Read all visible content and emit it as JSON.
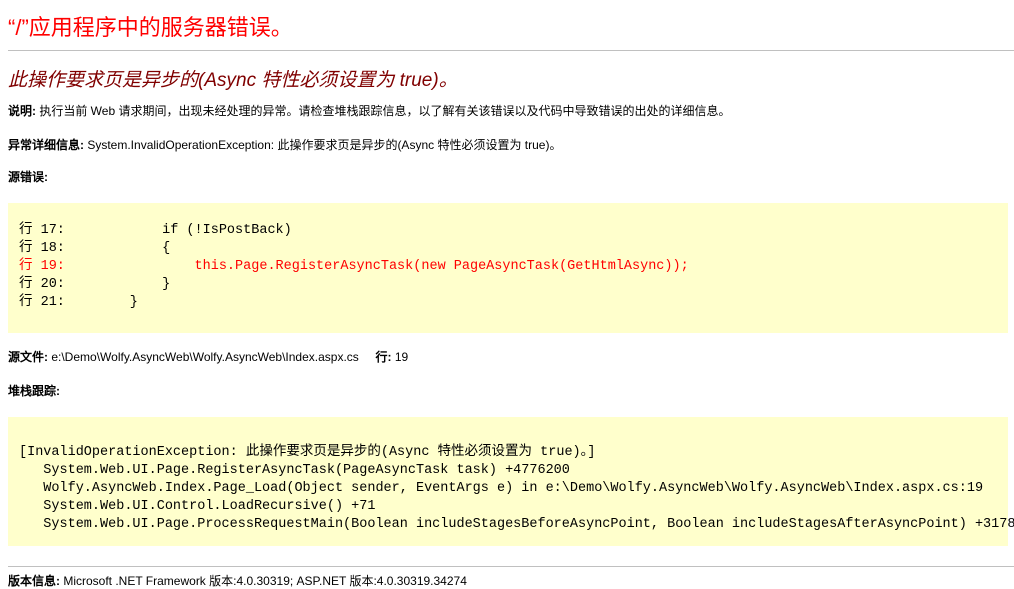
{
  "title": "“/”应用程序中的服务器错误。",
  "heading": "此操作要求页是异步的(Async 特性必须设置为 true)。",
  "description": {
    "label": "说明:",
    "text": "执行当前 Web 请求期间，出现未经处理的异常。请检查堆栈跟踪信息，以了解有关该错误以及代码中导致错误的出处的详细信息。"
  },
  "exception": {
    "label": "异常详细信息:",
    "text": "System.InvalidOperationException: 此操作要求页是异步的(Async 特性必须设置为 true)。"
  },
  "source_error": {
    "label": "源错误:",
    "lines": [
      {
        "text": "行 17:            if (!IsPostBack)",
        "highlight": false
      },
      {
        "text": "行 18:            {",
        "highlight": false
      },
      {
        "text": "行 19:                this.Page.RegisterAsyncTask(new PageAsyncTask(GetHtmlAsync));",
        "highlight": true
      },
      {
        "text": "行 20:            }",
        "highlight": false
      },
      {
        "text": "行 21:        }",
        "highlight": false
      }
    ]
  },
  "source_file": {
    "label": "源文件:",
    "path": "e:\\Demo\\Wolfy.AsyncWeb\\Wolfy.AsyncWeb\\Index.aspx.cs",
    "line_label": "行:",
    "line": "19"
  },
  "stack_trace": {
    "label": "堆栈跟踪:",
    "lines": [
      "[InvalidOperationException: 此操作要求页是异步的(Async 特性必须设置为 true)。]",
      "   System.Web.UI.Page.RegisterAsyncTask(PageAsyncTask task) +4776200",
      "   Wolfy.AsyncWeb.Index.Page_Load(Object sender, EventArgs e) in e:\\Demo\\Wolfy.AsyncWeb\\Wolfy.AsyncWeb\\Index.aspx.cs:19",
      "   System.Web.UI.Control.LoadRecursive() +71",
      "   System.Web.UI.Page.ProcessRequestMain(Boolean includeStagesBeforeAsyncPoint, Boolean includeStagesAfterAsyncPoint) +3178"
    ]
  },
  "version": {
    "label": "版本信息:",
    "text": "Microsoft .NET Framework 版本:4.0.30319; ASP.NET 版本:4.0.30319.34274"
  }
}
